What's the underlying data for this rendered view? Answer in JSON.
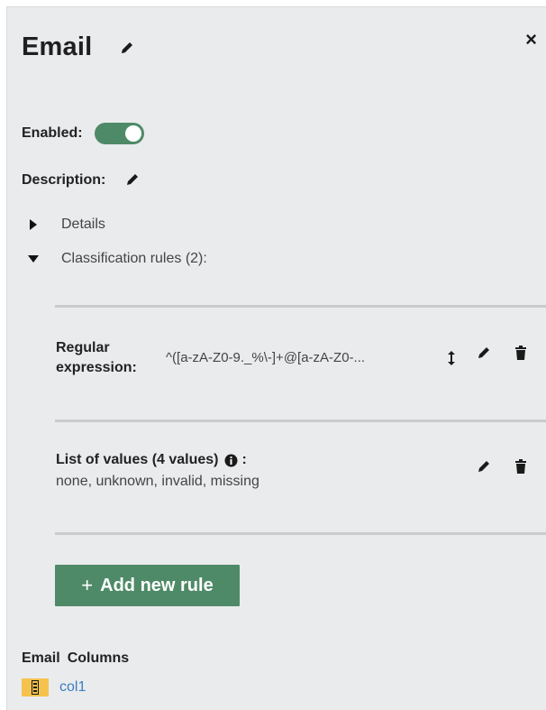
{
  "panel": {
    "title": "Email",
    "close_label": "×"
  },
  "enabled": {
    "label": "Enabled:",
    "value": true,
    "toggle_color": "#4f8a68"
  },
  "description": {
    "label": "Description:"
  },
  "sections": {
    "details_label": "Details",
    "details_expanded": false,
    "rules_label": "Classification rules (2):",
    "rules_expanded": true
  },
  "rules": [
    {
      "label_line1": "Regular",
      "label_line2": "expression:",
      "value": "^([a-zA-Z0-9._%\\-]+@[a-zA-Z0-...",
      "icons": [
        "sort-icon",
        "pencil-icon",
        "trash-icon"
      ]
    },
    {
      "title": "List of values (4 values)",
      "colon": ":",
      "values": "none, unknown, invalid, missing",
      "icons": [
        "info-icon",
        "pencil-icon",
        "trash-icon"
      ]
    }
  ],
  "add_rule": {
    "plus": "+",
    "label": "Add new rule",
    "color": "#4f8a68"
  },
  "columns": {
    "heading_type": "Email",
    "heading_label": "Columns",
    "items": [
      {
        "name": "col1",
        "icon": "column-type-icon",
        "icon_color": "#f5c34d"
      }
    ]
  }
}
